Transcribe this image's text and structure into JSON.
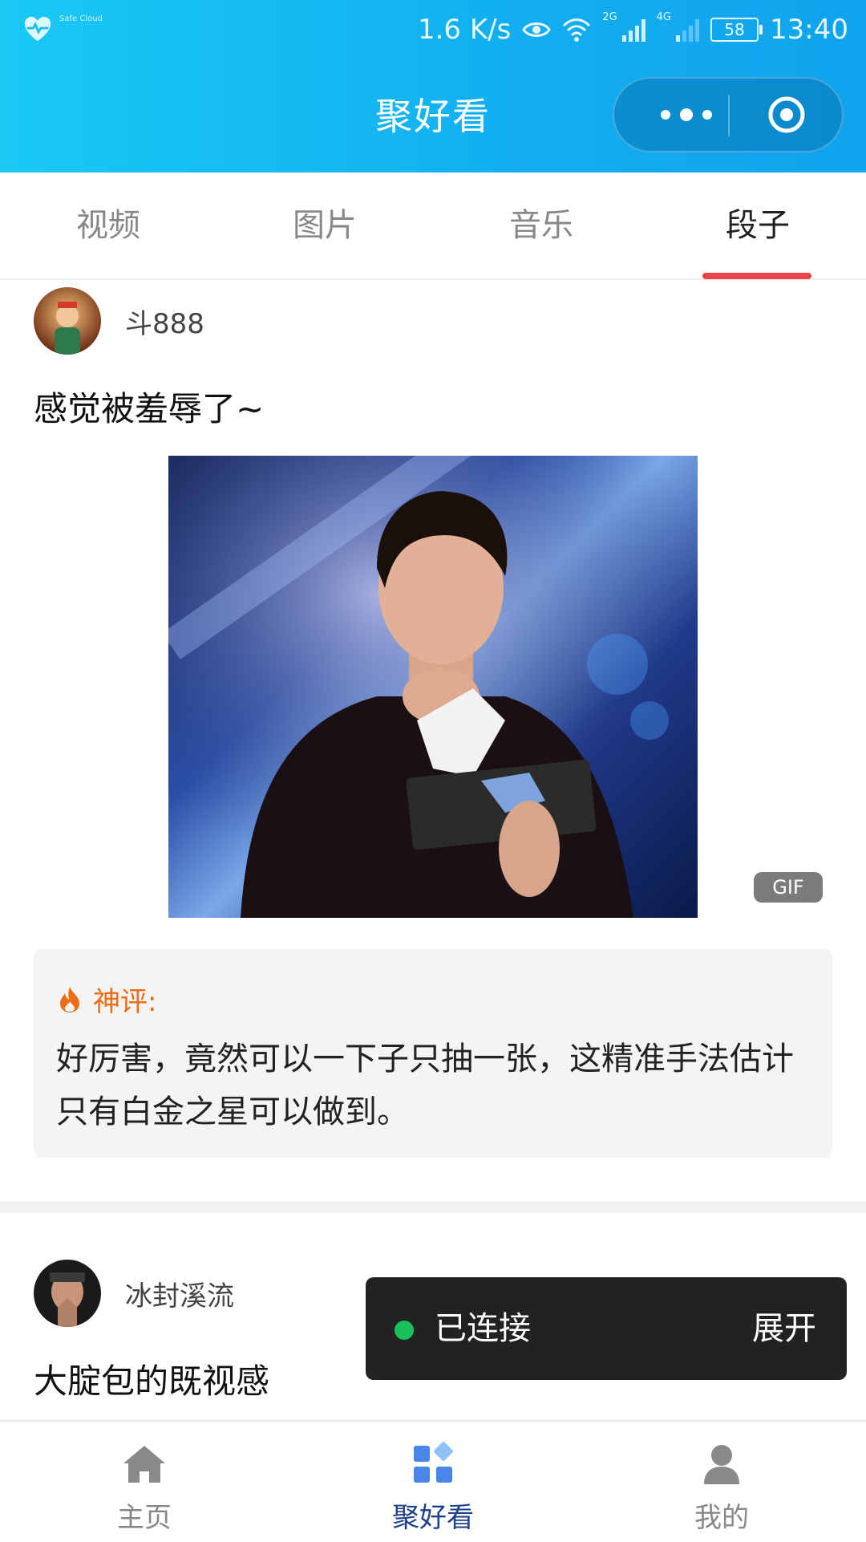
{
  "status_bar": {
    "app_label": "Safe Cloud",
    "network_speed": "1.6 K/s",
    "network_2g": "2G",
    "network_4g": "4G",
    "battery": "58",
    "time": "13:40"
  },
  "header": {
    "title": "聚好看",
    "more_icon": "ellipsis-icon",
    "close_icon": "target-circle-icon"
  },
  "tabs": [
    {
      "label": "视频",
      "active": false
    },
    {
      "label": "图片",
      "active": false
    },
    {
      "label": "音乐",
      "active": false
    },
    {
      "label": "段子",
      "active": true
    }
  ],
  "posts": [
    {
      "author": "斗888",
      "text": "感觉被羞辱了~",
      "badge": "GIF",
      "comment_label": "神评:",
      "comment_text": "好厉害，竟然可以一下子只抽一张，这精准手法估计只有白金之星可以做到。"
    },
    {
      "author": "冰封溪流",
      "text": "大腚包的既视感"
    }
  ],
  "toast": {
    "status": "已连接",
    "action": "展开",
    "status_color": "#18c15c"
  },
  "bottom_nav": [
    {
      "label": "主页",
      "icon": "home-icon",
      "active": false
    },
    {
      "label": "聚好看",
      "icon": "grid-apps-icon",
      "active": true
    },
    {
      "label": "我的",
      "icon": "user-icon",
      "active": false
    }
  ],
  "colors": {
    "header_gradient_start": "#19c9f4",
    "header_gradient_end": "#11a3ee",
    "tab_indicator": "#f2434c",
    "comment_label": "#ef6c17",
    "nav_active": "#1f3f8a"
  }
}
